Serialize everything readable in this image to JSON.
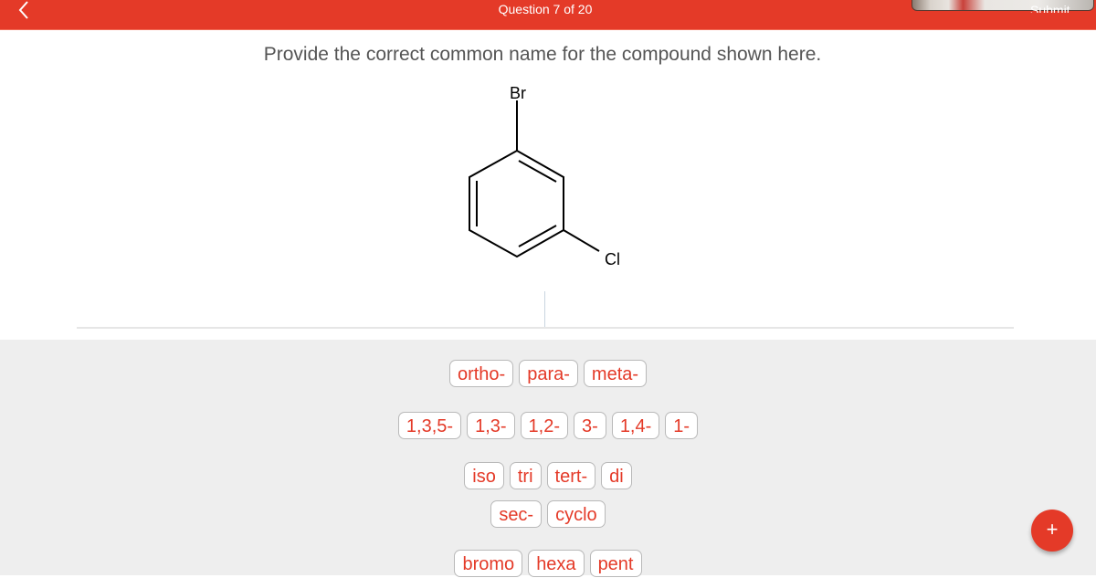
{
  "header": {
    "title": "Question 7 of 20",
    "back_icon": "chevron-left-icon",
    "submit_label": "Submit"
  },
  "question": {
    "prompt": "Provide the correct common name for the compound shown here.",
    "molecule": {
      "name_shown": "benzene ring with substituents",
      "substituents": [
        {
          "label": "Br",
          "position": "top"
        },
        {
          "label": "Cl",
          "position": "lower-right"
        }
      ]
    }
  },
  "answer": {
    "value": ""
  },
  "word_bank": {
    "rows": [
      [
        "ortho-",
        "para-",
        "meta-"
      ],
      [
        "1,3,5-",
        "1,3-",
        "1,2-",
        "3-",
        "1,4-",
        "1-"
      ],
      [
        "iso",
        "tri",
        "tert-",
        "di"
      ],
      [
        "sec-",
        "cyclo"
      ],
      [
        "bromo",
        "hexa",
        "pent"
      ]
    ]
  },
  "fab": {
    "label": "+",
    "icon": "plus-icon"
  },
  "colors": {
    "accent": "#e43a28",
    "bank_background": "#eeeeee"
  }
}
